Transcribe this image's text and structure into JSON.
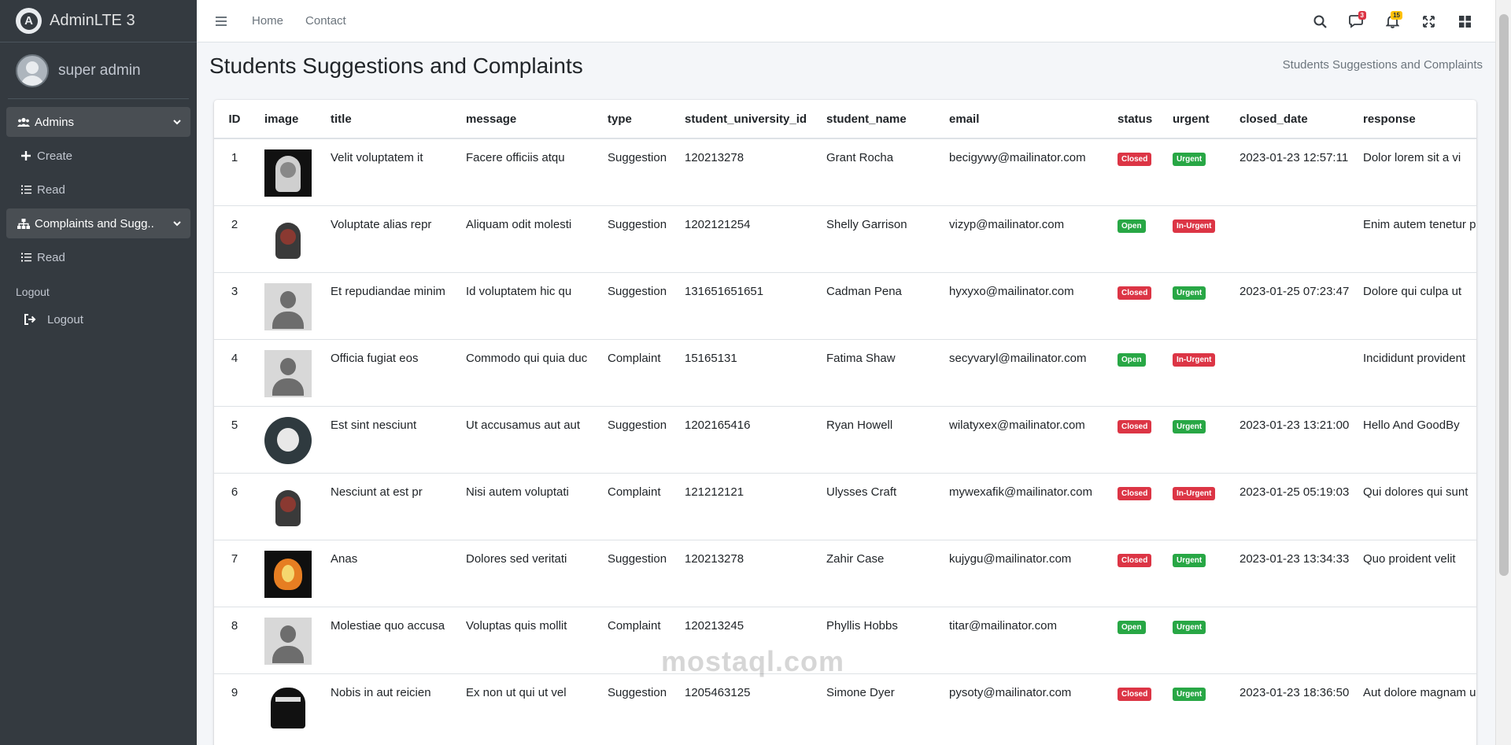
{
  "brand": {
    "name": "AdminLTE 3",
    "logo_letter": "A"
  },
  "user": {
    "name": "super admin"
  },
  "sidebar": {
    "groups": [
      {
        "label": "Admins",
        "icon": "users-icon",
        "items": [
          {
            "label": "Create",
            "icon": "plus-icon"
          },
          {
            "label": "Read",
            "icon": "list-icon"
          }
        ]
      },
      {
        "label": "Complaints and Sugg..",
        "icon": "sitemap-icon",
        "items": [
          {
            "label": "Read",
            "icon": "list-icon"
          }
        ]
      }
    ],
    "header": "Logout",
    "logout_label": "Logout"
  },
  "topbar": {
    "links": [
      "Home",
      "Contact"
    ],
    "messages_count": "3",
    "notifications_count": "15"
  },
  "page": {
    "title": "Students Suggestions and Complaints",
    "breadcrumb": "Students Suggestions and Complaints"
  },
  "table": {
    "columns": [
      "ID",
      "image",
      "title",
      "message",
      "type",
      "student_university_id",
      "student_name",
      "email",
      "status",
      "urgent",
      "closed_date",
      "response"
    ],
    "rows": [
      {
        "id": "1",
        "image": "dark",
        "title": "Velit voluptatem it",
        "message": "Facere officiis atqu",
        "type": "Suggestion",
        "uid": "120213278",
        "name": "Grant Rocha",
        "email": "becigywy@mailinator.com",
        "status": "Closed",
        "urgent": "Urgent",
        "closed_date": "2023-01-23 12:57:11",
        "response": "Dolor lorem sit a vi"
      },
      {
        "id": "2",
        "image": "light",
        "title": "Voluptate alias repr",
        "message": "Aliquam odit molesti",
        "type": "Suggestion",
        "uid": "1202121254",
        "name": "Shelly Garrison",
        "email": "vizyp@mailinator.com",
        "status": "Open",
        "urgent": "In-Urgent",
        "closed_date": "",
        "response": "Enim autem tenetur p"
      },
      {
        "id": "3",
        "image": "placeholder",
        "title": "Et repudiandae minim",
        "message": "Id voluptatem hic qu",
        "type": "Suggestion",
        "uid": "131651651651",
        "name": "Cadman Pena",
        "email": "hyxyxo@mailinator.com",
        "status": "Closed",
        "urgent": "Urgent",
        "closed_date": "2023-01-25 07:23:47",
        "response": "Dolore qui culpa ut"
      },
      {
        "id": "4",
        "image": "placeholder",
        "title": "Officia fugiat eos",
        "message": "Commodo qui quia duc",
        "type": "Complaint",
        "uid": "15165131",
        "name": "Fatima Shaw",
        "email": "secyvaryl@mailinator.com",
        "status": "Open",
        "urgent": "In-Urgent",
        "closed_date": "",
        "response": "Incididunt provident"
      },
      {
        "id": "5",
        "image": "round",
        "title": "Est sint nesciunt",
        "message": "Ut accusamus aut aut",
        "type": "Suggestion",
        "uid": "1202165416",
        "name": "Ryan Howell",
        "email": "wilatyxex@mailinator.com",
        "status": "Closed",
        "urgent": "Urgent",
        "closed_date": "2023-01-23 13:21:00",
        "response": "Hello And GoodBy"
      },
      {
        "id": "6",
        "image": "light",
        "title": "Nesciunt at est pr",
        "message": "Nisi autem voluptati",
        "type": "Complaint",
        "uid": "121212121",
        "name": "Ulysses Craft",
        "email": "mywexafik@mailinator.com",
        "status": "Closed",
        "urgent": "In-Urgent",
        "closed_date": "2023-01-25 05:19:03",
        "response": "Qui dolores qui sunt"
      },
      {
        "id": "7",
        "image": "fire",
        "title": "Anas",
        "message": "Dolores sed veritati",
        "type": "Suggestion",
        "uid": "120213278",
        "name": "Zahir Case",
        "email": "kujygu@mailinator.com",
        "status": "Closed",
        "urgent": "Urgent",
        "closed_date": "2023-01-23 13:34:33",
        "response": "Quo proident velit"
      },
      {
        "id": "8",
        "image": "placeholder",
        "title": "Molestiae quo accusa",
        "message": "Voluptas quis mollit",
        "type": "Complaint",
        "uid": "120213245",
        "name": "Phyllis Hobbs",
        "email": "titar@mailinator.com",
        "status": "Open",
        "urgent": "Urgent",
        "closed_date": "",
        "response": ""
      },
      {
        "id": "9",
        "image": "ninja",
        "title": "Nobis in aut reicien",
        "message": "Ex non ut qui ut vel",
        "type": "Suggestion",
        "uid": "1205463125",
        "name": "Simone Dyer",
        "email": "pysoty@mailinator.com",
        "status": "Closed",
        "urgent": "Urgent",
        "closed_date": "2023-01-23 18:36:50",
        "response": "Aut dolore magnam u"
      }
    ]
  },
  "colors": {
    "sidebar_bg": "#343a40",
    "closed": "#dc3545",
    "open": "#28a745",
    "urgent": "#28a745",
    "in_urgent": "#dc3545"
  },
  "watermark": "mostaql.com"
}
